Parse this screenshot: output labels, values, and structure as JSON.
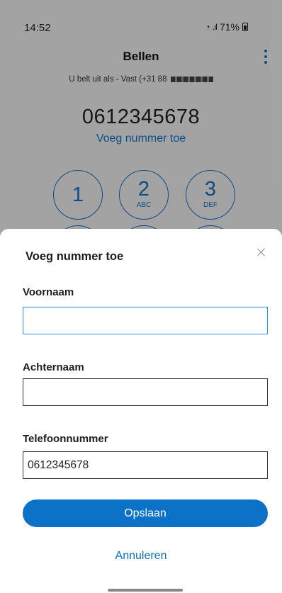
{
  "status_bar": {
    "time": "14:52",
    "battery": "71%",
    "icons": [
      "wifi-icon",
      "signal-icon",
      "battery-icon"
    ]
  },
  "dialer": {
    "title": "Bellen",
    "subtitle": "U belt uit als - Vast (+31 88",
    "number": "0612345678",
    "add_number_link": "Voeg nummer toe",
    "keys": [
      {
        "digit": "1",
        "letters": ""
      },
      {
        "digit": "2",
        "letters": "ABC"
      },
      {
        "digit": "3",
        "letters": "DEF"
      },
      {
        "digit": "",
        "letters": ""
      },
      {
        "digit": "",
        "letters": ""
      },
      {
        "digit": "",
        "letters": ""
      }
    ]
  },
  "dialog": {
    "title": "Voeg nummer toe",
    "first_name": {
      "label": "Voornaam",
      "value": ""
    },
    "last_name": {
      "label": "Achternaam",
      "value": ""
    },
    "phone": {
      "label": "Telefoonnummer",
      "value": "0612345678"
    },
    "save_label": "Opslaan",
    "cancel_label": "Annuleren"
  },
  "colors": {
    "accent": "#0b72c7",
    "focus_border": "#2f8fe0",
    "overlay": "rgba(0,0,0,0.33)"
  }
}
